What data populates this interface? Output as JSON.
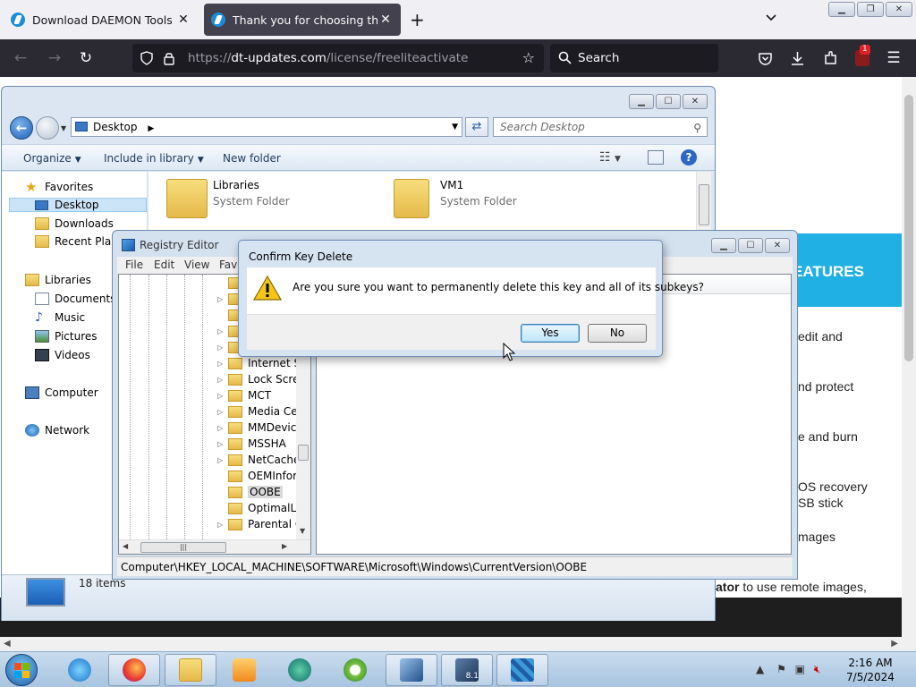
{
  "browser": {
    "tabs": [
      {
        "label": "Download DAEMON Tools for f",
        "active": false
      },
      {
        "label": "Thank you for choosing the be",
        "active": true
      }
    ],
    "url_prefix": "https://",
    "url_domain": "dt-updates.com",
    "url_path": "/license/freeliteactivate",
    "search_placeholder": "Search",
    "extension_badge": "1"
  },
  "webpage": {
    "heading_fragment": "EATURES",
    "lines": [
      "edit and",
      "nd protect",
      "e and burn",
      "OS recovery",
      "SB stick",
      "mages"
    ],
    "bold_fragment": "ator",
    "bold_suffix": " to use remote images,"
  },
  "explorer": {
    "address": "Desktop",
    "search_placeholder": "Search Desktop",
    "commands": {
      "organize": "Organize",
      "include": "Include in library",
      "new_folder": "New folder"
    },
    "nav": {
      "favorites": "Favorites",
      "desktop": "Desktop",
      "downloads": "Downloads",
      "recent": "Recent Places",
      "libraries": "Libraries",
      "documents": "Documents",
      "music": "Music",
      "pictures": "Pictures",
      "videos": "Videos",
      "computer": "Computer",
      "network": "Network"
    },
    "items": [
      {
        "name": "Libraries",
        "type": "System Folder"
      },
      {
        "name": "VM1",
        "type": "System Folder"
      }
    ],
    "item_count": "18 items"
  },
  "regedit": {
    "title": "Registry Editor",
    "menu": {
      "file": "File",
      "edit": "Edit",
      "view": "View",
      "favorites": "Fav"
    },
    "tree": [
      {
        "label": "Internet Se",
        "expandable": true,
        "selected": false
      },
      {
        "label": "Lock Scree",
        "expandable": true,
        "selected": false
      },
      {
        "label": "MCT",
        "expandable": true,
        "selected": false
      },
      {
        "label": "Media Cer",
        "expandable": true,
        "selected": false
      },
      {
        "label": "MMDevice",
        "expandable": true,
        "selected": false
      },
      {
        "label": "MSSHA",
        "expandable": true,
        "selected": false
      },
      {
        "label": "NetCache",
        "expandable": true,
        "selected": false
      },
      {
        "label": "OEMInforr",
        "expandable": false,
        "selected": false
      },
      {
        "label": "OOBE",
        "expandable": false,
        "selected": true
      },
      {
        "label": "OptimalLa",
        "expandable": false,
        "selected": false
      },
      {
        "label": "Parental C",
        "expandable": true,
        "selected": false
      }
    ],
    "status_path": "Computer\\HKEY_LOCAL_MACHINE\\SOFTWARE\\Microsoft\\Windows\\CurrentVersion\\OOBE"
  },
  "dialog": {
    "title": "Confirm Key Delete",
    "message": "Are you sure you want to permanently delete this key and all of its subkeys?",
    "yes_label": "Yes",
    "no_label": "No"
  },
  "taskbar": {
    "time": "2:16 AM",
    "date": "7/5/2024",
    "vmware_badge": "8.1"
  }
}
